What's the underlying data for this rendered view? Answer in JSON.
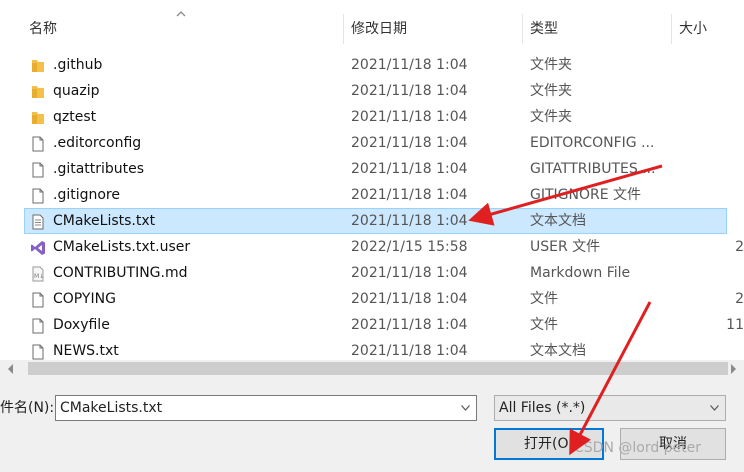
{
  "columns": {
    "name": "名称",
    "date": "修改日期",
    "type": "类型",
    "size": "大小"
  },
  "files": [
    {
      "icon": "folder-icon",
      "name": ".github",
      "date": "2021/11/18 1:04",
      "type": "文件夹",
      "size": ""
    },
    {
      "icon": "folder-icon",
      "name": "quazip",
      "date": "2021/11/18 1:04",
      "type": "文件夹",
      "size": ""
    },
    {
      "icon": "folder-icon",
      "name": "qztest",
      "date": "2021/11/18 1:04",
      "type": "文件夹",
      "size": ""
    },
    {
      "icon": "file-icon",
      "name": ".editorconfig",
      "date": "2021/11/18 1:04",
      "type": "EDITORCONFIG ...",
      "size": ""
    },
    {
      "icon": "file-icon",
      "name": ".gitattributes",
      "date": "2021/11/18 1:04",
      "type": "GITATTRIBUTES ...",
      "size": ""
    },
    {
      "icon": "file-icon",
      "name": ".gitignore",
      "date": "2021/11/18 1:04",
      "type": "GITIGNORE 文件",
      "size": ""
    },
    {
      "icon": "text-document-icon",
      "name": "CMakeLists.txt",
      "date": "2021/11/18 1:04",
      "type": "文本文档",
      "size": "",
      "selected": true
    },
    {
      "icon": "visual-studio-icon",
      "name": "CMakeLists.txt.user",
      "date": "2022/1/15 15:58",
      "type": "USER 文件",
      "size": "2"
    },
    {
      "icon": "markdown-file-icon",
      "name": "CONTRIBUTING.md",
      "date": "2021/11/18 1:04",
      "type": "Markdown File",
      "size": ""
    },
    {
      "icon": "file-icon",
      "name": "COPYING",
      "date": "2021/11/18 1:04",
      "type": "文件",
      "size": "2"
    },
    {
      "icon": "file-icon",
      "name": "Doxyfile",
      "date": "2021/11/18 1:04",
      "type": "文件",
      "size": "11"
    },
    {
      "icon": "file-icon",
      "name": "NEWS.txt",
      "date": "2021/11/18 1:04",
      "type": "文本文档",
      "size": ""
    }
  ],
  "filename": {
    "label": "件名(N):",
    "value": "CMakeLists.txt"
  },
  "filetype": {
    "selected": "All Files (*.*)"
  },
  "buttons": {
    "open": "打开(O)",
    "cancel": "取消"
  },
  "watermark": "CSDN @lord peter",
  "colors": {
    "selection": "#cce8ff",
    "selection_border": "#99d1ff",
    "folder": "#f5c04a",
    "annotation_arrow": "#e02020",
    "vs_purple": "#8661c5",
    "focus_border": "#0078d7"
  }
}
